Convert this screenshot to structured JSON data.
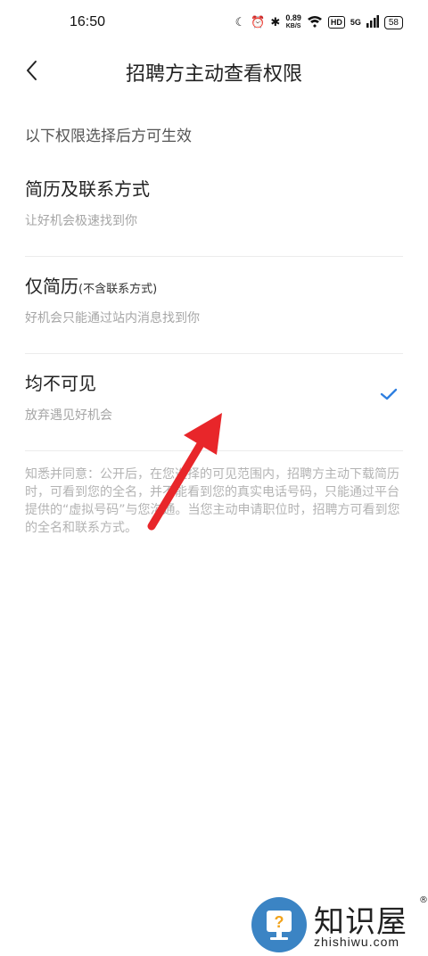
{
  "status": {
    "time": "16:50",
    "net_speed": "0.89",
    "net_unit": "KB/S",
    "hd": "HD",
    "signal": "5G",
    "battery": "58"
  },
  "nav": {
    "title": "招聘方主动查看权限"
  },
  "hint": "以下权限选择后方可生效",
  "options": [
    {
      "title": "简历及联系方式",
      "suffix": "",
      "desc": "让好机会极速找到你",
      "selected": false
    },
    {
      "title": "仅简历",
      "suffix": "(不含联系方式)",
      "desc": "好机会只能通过站内消息找到你",
      "selected": false
    },
    {
      "title": "均不可见",
      "suffix": "",
      "desc": "放弃遇见好机会",
      "selected": true
    }
  ],
  "notice": "知悉并同意：公开后，在您选择的可见范围内，招聘方主动下载简历时，可看到您的全名，并不能看到您的真实电话号码，只能通过平台提供的“虚拟号码”与您沟通。当您主动申请职位时，招聘方可看到您的全名和联系方式。",
  "watermark": {
    "brand": "知识屋",
    "url": "zhishiwu.com",
    "registered": "®"
  },
  "colors": {
    "accent": "#2f7fe0",
    "arrow": "#e8262a",
    "logo": "#3b84c4"
  }
}
